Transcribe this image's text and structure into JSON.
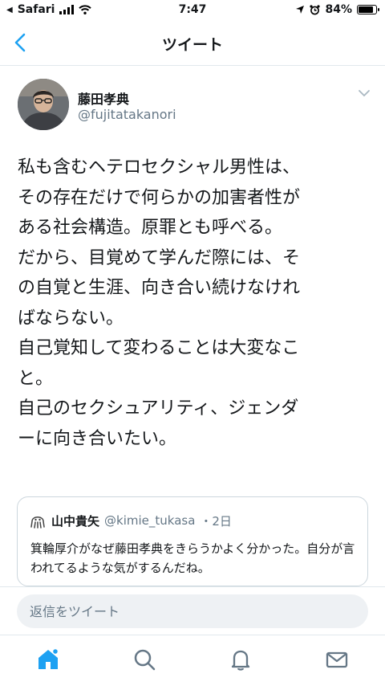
{
  "status_bar": {
    "back_app": "Safari",
    "time": "7:47",
    "battery": "84%",
    "battery_level": 0.84
  },
  "nav": {
    "title": "ツイート"
  },
  "tweet": {
    "author_name": "藤田孝典",
    "author_handle": "@fujitatakanori",
    "body": "私も含むヘテロセクシャル男性は、\nその存在だけで何らかの加害者性が\nある社会構造。原罪とも呼べる。\nだから、目覚めて学んだ際には、そ\nの自覚と生涯、向き合い続けなけれ\nばならない。\n自己覚知して変わることは大変なこ\nと。\n自己のセクシュアリティ、ジェンダ\nーに向き合いたい。"
  },
  "quote": {
    "name": "山中貴矢",
    "handle": "@kimie_tukasa",
    "time": "・2日",
    "text": "箕輪厚介がなぜ藤田孝典をきらうかよく分かった。自分が言われてるような気がするんだね。"
  },
  "reply": {
    "placeholder": "返信をツイート"
  },
  "tabs": [
    "home-icon",
    "search-icon",
    "notifications-icon",
    "messages-icon"
  ],
  "colors": {
    "accent": "#1da1f2",
    "secondary_text": "#657786"
  }
}
